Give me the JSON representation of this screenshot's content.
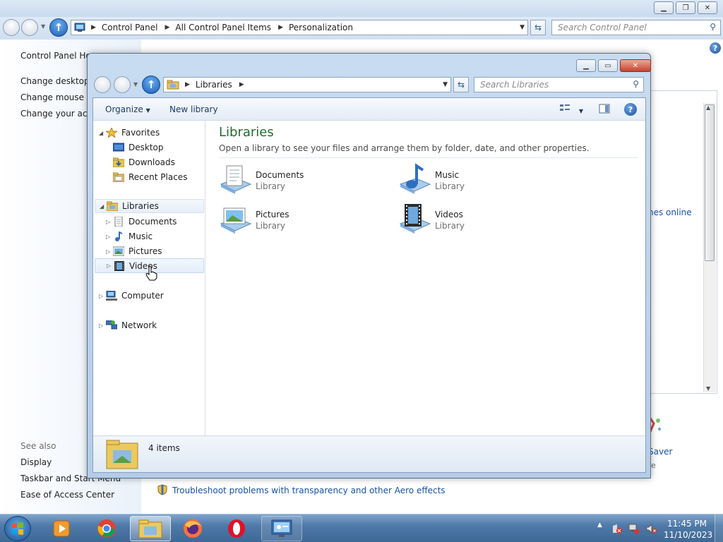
{
  "control_panel": {
    "address": {
      "crumbs": [
        "Control Panel",
        "All Control Panel Items",
        "Personalization"
      ]
    },
    "search_placeholder": "Search Control Panel",
    "left_links": [
      "Control Panel Hor",
      "Change desktop i",
      "Change mouse po",
      "Change your acco"
    ],
    "see_also_label": "See also",
    "see_also": [
      "Display",
      "Taskbar and Start Menu",
      "Ease of Access Center"
    ],
    "partial_link": "nes online",
    "partial_saver": "Saver",
    "partial_e": "e",
    "troubleshoot": "Troubleshoot problems with transparency and other Aero effects"
  },
  "libraries_window": {
    "address": {
      "crumbs": [
        "Libraries"
      ]
    },
    "search_placeholder": "Search Libraries",
    "toolbar": {
      "organize": "Organize",
      "new_library": "New library"
    },
    "nav": {
      "favorites": "Favorites",
      "favorites_items": [
        "Desktop",
        "Downloads",
        "Recent Places"
      ],
      "libraries": "Libraries",
      "libraries_items": [
        "Documents",
        "Music",
        "Pictures",
        "Videos"
      ],
      "computer": "Computer",
      "network": "Network"
    },
    "content": {
      "title": "Libraries",
      "subtitle": "Open a library to see your files and arrange them by folder, date, and other properties.",
      "items": [
        {
          "name": "Documents",
          "type": "Library",
          "icon": "documents-library-icon"
        },
        {
          "name": "Music",
          "type": "Library",
          "icon": "music-library-icon"
        },
        {
          "name": "Pictures",
          "type": "Library",
          "icon": "pictures-library-icon"
        },
        {
          "name": "Videos",
          "type": "Library",
          "icon": "videos-library-icon"
        }
      ]
    },
    "details": {
      "count": "4 items"
    }
  },
  "taskbar": {
    "time": "11:45 PM",
    "date": "11/10/2023"
  },
  "colors": {
    "library_title": "#1f6b2f",
    "link_blue": "#1551a9",
    "taskbar": "#4f79a8"
  }
}
